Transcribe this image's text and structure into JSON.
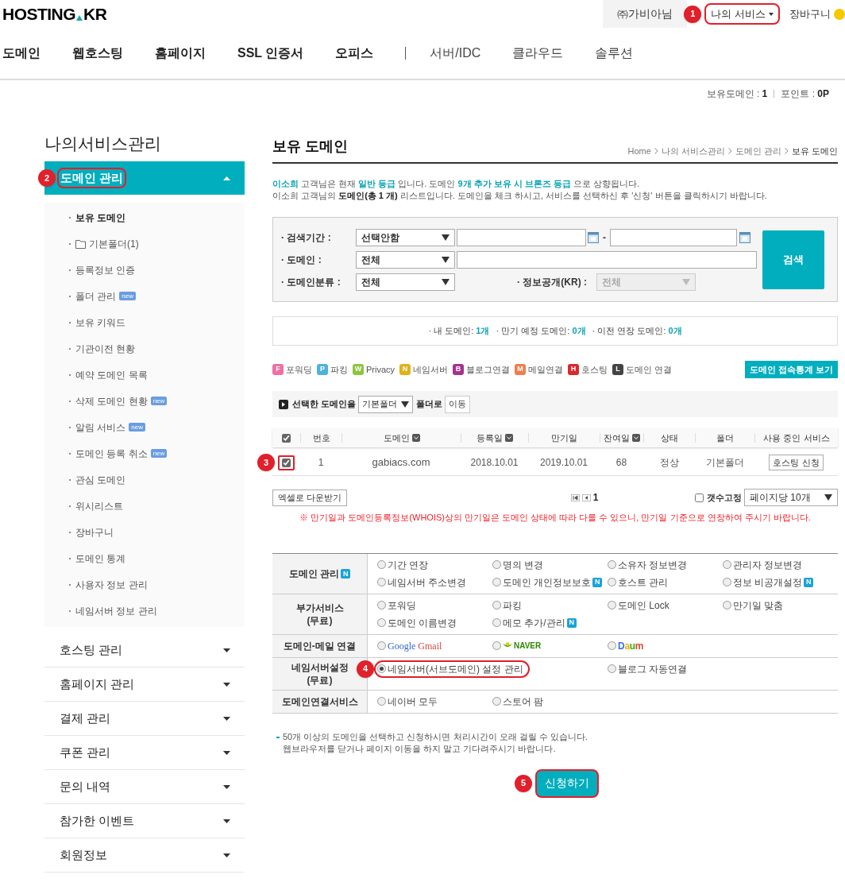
{
  "header": {
    "logo": {
      "left": "HOSTING",
      "right": "KR"
    },
    "user": "㈜가비아님",
    "my_service": {
      "label": "나의 서비스",
      "callout": "1"
    },
    "cart": "장바구니"
  },
  "nav": [
    {
      "kind": "link",
      "label": "도메인",
      "muted": false
    },
    {
      "kind": "link",
      "label": "웹호스팅",
      "muted": false
    },
    {
      "kind": "link",
      "label": "홈페이지",
      "muted": false
    },
    {
      "kind": "link",
      "label": "SSL 인증서",
      "muted": false
    },
    {
      "kind": "link",
      "label": "오피스",
      "muted": false
    },
    {
      "kind": "divider"
    },
    {
      "kind": "link",
      "label": "서버/IDC",
      "muted": true
    },
    {
      "kind": "link",
      "label": "클라우드",
      "muted": true
    },
    {
      "kind": "link",
      "label": "솔루션",
      "muted": true
    }
  ],
  "info_bar": [
    {
      "label": "보유도메인 :",
      "value": "1"
    },
    {
      "label": "포인트 :",
      "value": "0P"
    }
  ],
  "sidebar": {
    "title": "나의서비스관리",
    "sections": [
      {
        "label": "도메인 관리",
        "expanded": true,
        "callout": "2",
        "children": [
          {
            "kind": "link",
            "label": "보유 도메인",
            "selected": true
          },
          {
            "kind": "folder",
            "label": "기본폴더(1)",
            "selected": false
          },
          {
            "kind": "link",
            "label": "등록정보 인증",
            "selected": false
          },
          {
            "kind": "link",
            "label": "폴더 관리",
            "badge": "new",
            "selected": false
          },
          {
            "kind": "link",
            "label": "보유 키워드",
            "selected": false
          },
          {
            "kind": "link",
            "label": "기관이전 현황",
            "selected": false
          },
          {
            "kind": "link",
            "label": "예약 도메인 목록",
            "selected": false
          },
          {
            "kind": "link",
            "label": "삭제 도메인 현황",
            "badge": "new",
            "selected": false
          },
          {
            "kind": "link",
            "label": "알림 서비스",
            "badge": "new",
            "selected": false
          },
          {
            "kind": "link",
            "label": "도메인 등록 취소",
            "badge": "new",
            "selected": false
          },
          {
            "kind": "link",
            "label": "관심 도메인",
            "selected": false
          },
          {
            "kind": "link",
            "label": "위시리스트",
            "selected": false
          },
          {
            "kind": "link",
            "label": "장바구니",
            "selected": false
          },
          {
            "kind": "link",
            "label": "도메인 통계",
            "selected": false
          },
          {
            "kind": "link",
            "label": "사용자 정보 관리",
            "selected": false
          },
          {
            "kind": "link",
            "label": "네임서버 정보 관리",
            "selected": false
          }
        ]
      },
      {
        "label": "호스팅 관리",
        "expanded": false
      },
      {
        "label": "홈페이지 관리",
        "expanded": false
      },
      {
        "label": "결제 관리",
        "expanded": false
      },
      {
        "label": "쿠폰 관리",
        "expanded": false
      },
      {
        "label": "문의 내역",
        "expanded": false
      },
      {
        "label": "참가한 이벤트",
        "expanded": false
      },
      {
        "label": "회원정보",
        "expanded": false
      }
    ]
  },
  "page": {
    "title": "보유 도메인",
    "breadcrumb": [
      "Home",
      "나의 서비스관리",
      "도메인 관리",
      "보유 도메인"
    ]
  },
  "notice": [
    {
      "kind": "accent",
      "text": "**이소희** 고객님은 현재 **일반 등급** 입니다. 도메인 **9개 추가 보유 시 브론즈 등급** 으로 상향됩니다."
    },
    {
      "kind": "plain",
      "text": "이소희 고객님의 **도메인(총 1 개)** 리스트입니다. 도메인을 체크 하시고, 서비스를 선택하신 후 '신청' 버튼을 클릭하시기 바랍니다."
    }
  ],
  "search": {
    "period_label": "· 검색기간 :",
    "period_select": "선택안함",
    "date_separator": "-",
    "domain_label": "· 도메인 :",
    "domain_select": "전체",
    "category_label": "· 도메인분류 :",
    "category_select": "전체",
    "disclosure_label": "· 정보공개(KR) :",
    "disclosure_select": {
      "value": "전체",
      "disabled": true
    },
    "button": "검색"
  },
  "summary": [
    {
      "label": "· 내 도메인:",
      "value": "1개"
    },
    {
      "label": "· 만기 예정 도메인:",
      "value": "0개"
    },
    {
      "label": "· 이전 연장 도메인:",
      "value": "0개"
    }
  ],
  "legend": [
    {
      "letter": "F",
      "label": "포워딩",
      "color": "#f06fa5"
    },
    {
      "letter": "P",
      "label": "파킹",
      "color": "#4db3d8"
    },
    {
      "letter": "W",
      "label": "Privacy",
      "color": "#8cc63f"
    },
    {
      "letter": "N",
      "label": "네임서버",
      "color": "#e0b21a"
    },
    {
      "letter": "B",
      "label": "블로그연결",
      "color": "#a2348e"
    },
    {
      "letter": "M",
      "label": "메일연결",
      "color": "#f07d4d"
    },
    {
      "letter": "H",
      "label": "호스팅",
      "color": "#d9282f"
    },
    {
      "letter": "L",
      "label": "도메인 연결",
      "color": "#444444"
    }
  ],
  "stats_button": "도메인 접속통계 보기",
  "move_bar": {
    "before": "선택한 도메인을",
    "folder": "기본폴더",
    "after": "폴더로",
    "button": "이동"
  },
  "table": {
    "all_checked": true,
    "columns": [
      {
        "label": "번호",
        "sortable": false
      },
      {
        "label": "도메인",
        "sortable": true
      },
      {
        "label": "등록일",
        "sortable": true
      },
      {
        "label": "만기일",
        "sortable": false
      },
      {
        "label": "잔여일",
        "sortable": true
      },
      {
        "label": "상태",
        "sortable": false
      },
      {
        "label": "폴더",
        "sortable": false
      },
      {
        "label": "사용 중인 서비스",
        "sortable": false
      }
    ],
    "rows": [
      {
        "checked": true,
        "callout": "3",
        "cells": [
          "1",
          "gabiacs.com",
          "2018.10.01",
          "2019.10.01",
          "68",
          "정상",
          "기본폴더"
        ],
        "action": "호스팅 신청"
      }
    ]
  },
  "excel_button": "엑셀로 다운받기",
  "pagination": {
    "page": "1"
  },
  "fix_count": {
    "label": "갯수고정",
    "checked": false
  },
  "per_page": "페이지당 10개",
  "warning": "※ 만기일과 도메인등록정보(WHOIS)상의 만기일은 도메인 상태에 따라 다를 수 있으니, 만기일 기준으로 연장하여 주시기 바랍니다.",
  "services": [
    {
      "label": [
        "도메인 관리"
      ],
      "badge": "N",
      "options": [
        {
          "kind": "text",
          "label": "기간 연장",
          "selected": false
        },
        {
          "kind": "text",
          "label": "명의 변경",
          "selected": false
        },
        {
          "kind": "text",
          "label": "소유자 정보변경",
          "selected": false
        },
        {
          "kind": "text",
          "label": "관리자 정보변경",
          "selected": false
        },
        {
          "kind": "text",
          "label": "네임서버 주소변경",
          "selected": false
        },
        {
          "kind": "text",
          "label": "도메인 개인정보보호",
          "badge": "N",
          "selected": false
        },
        {
          "kind": "text",
          "label": "호스트 관리",
          "selected": false
        },
        {
          "kind": "text",
          "label": "정보 비공개설정",
          "badge": "N",
          "selected": false
        }
      ]
    },
    {
      "label": [
        "부가서비스",
        "(무료)"
      ],
      "options": [
        {
          "kind": "text",
          "label": "포워딩",
          "selected": false
        },
        {
          "kind": "text",
          "label": "파킹",
          "selected": false
        },
        {
          "kind": "text",
          "label": "도메인 Lock",
          "selected": false
        },
        {
          "kind": "text",
          "label": "만기일 맞춤",
          "selected": false
        },
        {
          "kind": "text",
          "label": "도메인 이름변경",
          "selected": false
        },
        {
          "kind": "text",
          "label": "메모 추가/관리",
          "badge": "N",
          "selected": false
        }
      ]
    },
    {
      "label": [
        "도메인-메일 연결"
      ],
      "options": [
        {
          "kind": "google",
          "label": "Google",
          "label2": "Gmail",
          "selected": false
        },
        {
          "kind": "naver",
          "label": "NAVER",
          "selected": false
        },
        {
          "kind": "daum",
          "label": "Daum",
          "selected": false
        }
      ]
    },
    {
      "label": [
        "네임서버설정",
        "(무료)"
      ],
      "options": [
        {
          "kind": "text",
          "label": "네임서버(서브도메인) 설정 관리",
          "selected": true,
          "callout": "4"
        },
        {
          "kind": "text",
          "label": "블로그 자동연결",
          "selected": false
        }
      ]
    },
    {
      "label": [
        "도메인연결서비스"
      ],
      "options": [
        {
          "kind": "text",
          "label": "네이버 모두",
          "selected": false
        },
        {
          "kind": "text",
          "label": "스토어 팜",
          "selected": false
        }
      ]
    }
  ],
  "notes": [
    "50개 이상의 도메인을 선택하고 신청하시면 처리시간이 오래 걸릴 수 있습니다.",
    "웹브라우저를 닫거나 페이지 이동을 하지 말고 기다려주시기 바랍니다."
  ],
  "submit": {
    "label": "신청하기",
    "callout": "5"
  }
}
